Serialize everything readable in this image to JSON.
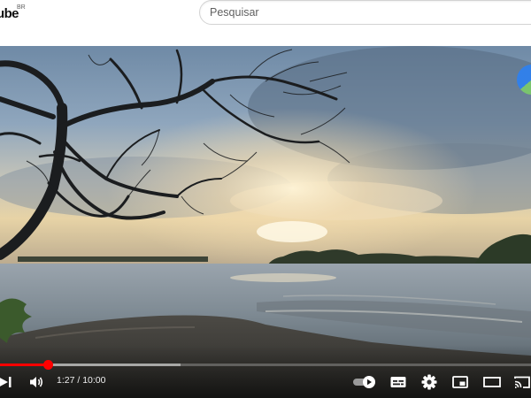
{
  "header": {
    "logo_text": "ube",
    "country_code": "BR",
    "search_placeholder": "Pesquisar"
  },
  "player": {
    "current_time": "1:27",
    "time_separator": " / ",
    "duration": "10:00",
    "progress_fraction": 0.09,
    "buffered_fraction": 0.34,
    "accent_color": "#ff0000"
  },
  "icons": {
    "next": "next-icon",
    "volume": "volume-icon",
    "autoplay": "autoplay-toggle-icon",
    "subtitles": "subtitles-icon",
    "settings": "gear-icon",
    "miniplayer": "miniplayer-icon",
    "theater": "theater-mode-icon",
    "cast": "cast-icon"
  }
}
